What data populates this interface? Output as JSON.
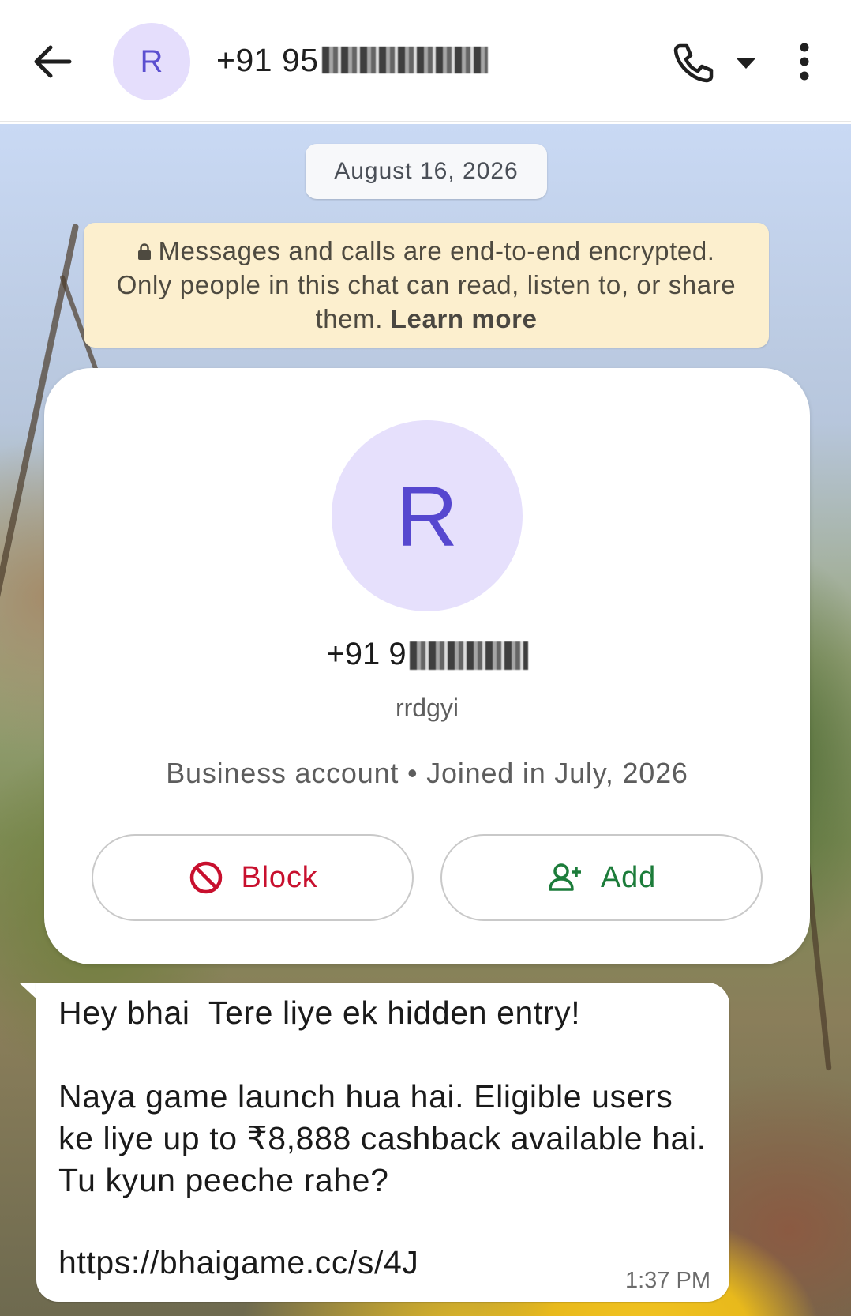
{
  "header": {
    "avatar_initial": "R",
    "contact_number": "+91 95",
    "icons": {
      "back": "arrow-left-icon",
      "call": "phone-icon",
      "call_menu": "caret-down-icon",
      "menu": "more-vert-icon"
    }
  },
  "chat": {
    "date_label": "August 16, 2026",
    "encryption_notice": "Messages and calls are end-to-end encrypted. Only people in this chat can read, listen to, or share them.",
    "encryption_link": "Learn more"
  },
  "contact_card": {
    "avatar_initial": "R",
    "number": "+91 9",
    "username": "rrdgyi",
    "meta": "Business account • Joined in July, 2026",
    "block_label": "Block",
    "add_label": "Add",
    "colors": {
      "block": "#c8102e",
      "add": "#1c7c3a",
      "avatar_bg": "#e6e0fc",
      "avatar_fg": "#5647cf"
    }
  },
  "message": {
    "text": "Hey bhai  Tere liye ek hidden entry!\n\nNaya game launch hua hai. Eligible users ke liye up to ₹8,888 cashback available hai. Tu kyun peeche rahe?",
    "link": "https://bhaigame.cc/s/4J",
    "time": "1:37 PM"
  }
}
